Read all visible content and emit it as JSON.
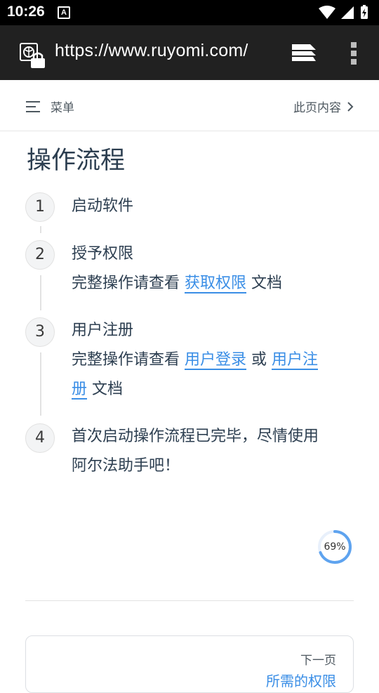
{
  "status_bar": {
    "time": "10:26",
    "notif_letter": "A"
  },
  "browser": {
    "url": "https://www.ruyomi.com/"
  },
  "nav": {
    "menu_label": "菜单",
    "toc_label": "此页内容"
  },
  "page": {
    "title": "操作流程",
    "steps": [
      {
        "num": "1",
        "line1": "启动软件"
      },
      {
        "num": "2",
        "line1": "授予权限",
        "pre": "完整操作请查看 ",
        "link1": "获取权限",
        "post": " 文档"
      },
      {
        "num": "3",
        "line1": "用户注册",
        "pre": "完整操作请查看 ",
        "link1": "用户登录",
        "mid": " 或 ",
        "link2a": "用户注",
        "link2b": "册",
        "post": " 文档"
      },
      {
        "num": "4",
        "line1": "首次启动操作流程已完毕，尽情使用",
        "line2": "阿尔法助手吧！"
      }
    ],
    "progress": {
      "label": "69%",
      "value": 0.69
    },
    "next": {
      "label": "下一页",
      "title": "所需的权限"
    }
  },
  "colors": {
    "accent": "#3a8ee6",
    "toolbar": "#212121",
    "text": "#2c3e50"
  }
}
